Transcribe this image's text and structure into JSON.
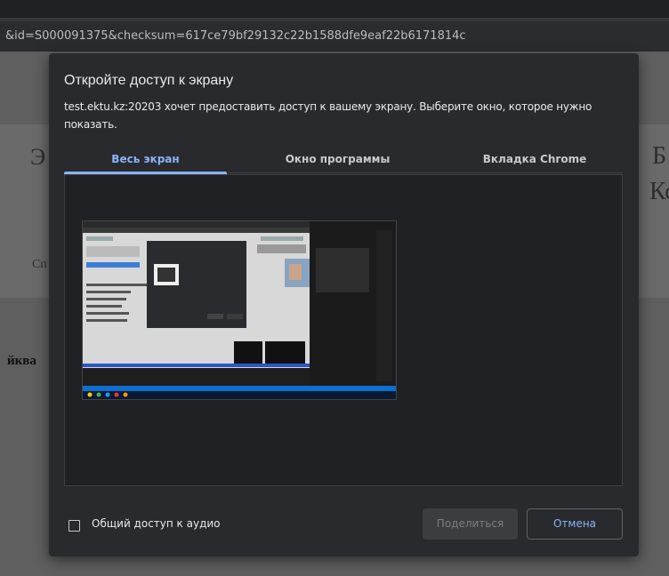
{
  "browser": {
    "url_fragment": "&id=S000091375&checksum=617ce79bf29132c22b1588dfe9eaf22b6171814c"
  },
  "background_page": {
    "left_heading_fragment": "Э",
    "left_subtext_fragment": "Сп",
    "left_body_fragment": "йква",
    "right_heading_fragment_1": "Б",
    "right_heading_fragment_2": "Ко"
  },
  "dialog": {
    "title": "Откройте доступ к экрану",
    "description": "test.ektu.kz:20203 хочет предоставить доступ к вашему экрану. Выберите окно, которое нужно показать.",
    "tabs": [
      {
        "label": "Весь экран",
        "active": true
      },
      {
        "label": "Окно программы",
        "active": false
      },
      {
        "label": "Вкладка Chrome",
        "active": false
      }
    ],
    "audio_checkbox": {
      "label": "Общий доступ к аудио",
      "checked": false
    },
    "share_button": "Поделиться",
    "cancel_button": "Отмена"
  },
  "colors": {
    "accent": "#8ab4f8",
    "dialog_bg": "#292a2d",
    "panel_bg": "#202124",
    "text": "#e8eaed"
  }
}
